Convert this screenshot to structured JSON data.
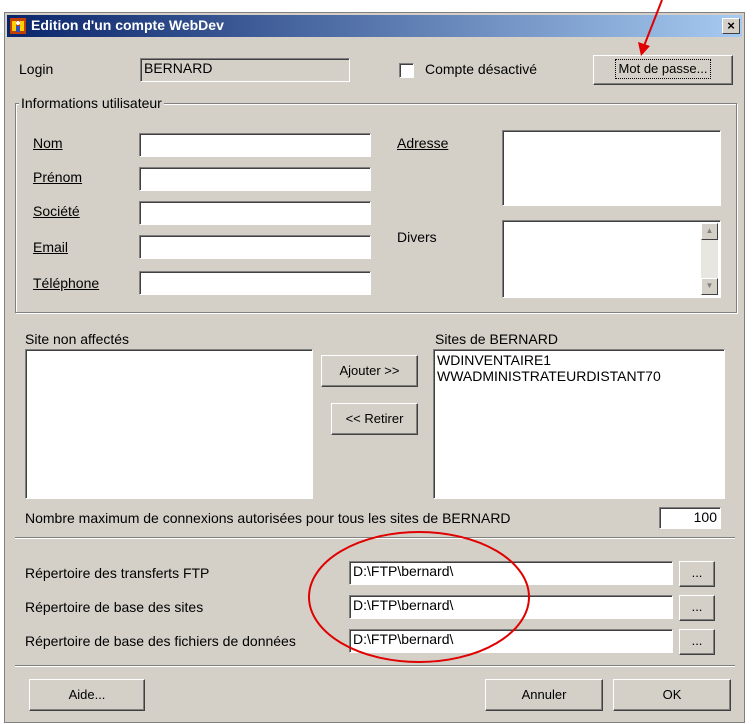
{
  "window": {
    "title": "Edition d'un compte WebDev",
    "close_label": "×"
  },
  "login": {
    "label": "Login",
    "value": "BERNARD"
  },
  "account_disabled": {
    "label": "Compte désactivé",
    "checked": false
  },
  "password_button": "Mot de passe...",
  "user_info": {
    "title": "Informations utilisateur",
    "nom": "Nom",
    "prenom": "Prénom",
    "societe": "Société",
    "email": "Email",
    "telephone": "Téléphone",
    "adresse": "Adresse",
    "divers": "Divers"
  },
  "sites": {
    "unassigned_label": "Site non affectés",
    "assigned_label": "Sites de  BERNARD",
    "assigned_items": [
      "WDINVENTAIRE1",
      "WWADMINISTRATEURDISTANT70"
    ],
    "add_button": "Ajouter >>",
    "remove_button": "<< Retirer"
  },
  "max_connections": {
    "label": "Nombre maximum de connexions autorisées pour tous les sites de  BERNARD",
    "value": "100"
  },
  "directories": {
    "ftp_label": "Répertoire des transferts FTP",
    "ftp_value": "D:\\FTP\\bernard\\",
    "sites_label": "Répertoire de base des sites",
    "sites_value": "D:\\FTP\\bernard\\",
    "data_label": "Répertoire de base des fichiers de données",
    "data_value": "D:\\FTP\\bernard\\",
    "browse_label": "..."
  },
  "buttons": {
    "help": "Aide...",
    "cancel": "Annuler",
    "ok": "OK"
  },
  "colors": {
    "annotation": "#e00000",
    "titlebar": "#0a246a"
  }
}
